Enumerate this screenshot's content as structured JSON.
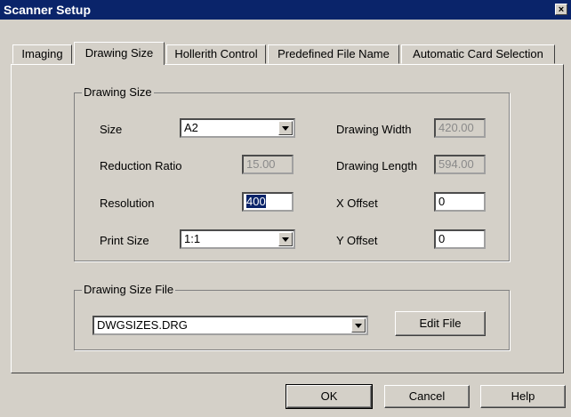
{
  "window": {
    "title": "Scanner Setup",
    "close_glyph": "×"
  },
  "tabs": [
    {
      "label": "Imaging"
    },
    {
      "label": "Drawing Size"
    },
    {
      "label": "Hollerith Control"
    },
    {
      "label": "Predefined File Name"
    },
    {
      "label": "Automatic Card Selection"
    }
  ],
  "drawing_size": {
    "group_label": "Drawing Size",
    "size_label": "Size",
    "size_value": "A2",
    "reduction_label": "Reduction Ratio",
    "reduction_value": "15.00",
    "resolution_label": "Resolution",
    "resolution_value": "400",
    "print_size_label": "Print Size",
    "print_size_value": "1:1",
    "width_label": "Drawing Width",
    "width_value": "420.00",
    "length_label": "Drawing Length",
    "length_value": "594.00",
    "x_offset_label": "X Offset",
    "x_offset_value": "0",
    "y_offset_label": "Y Offset",
    "y_offset_value": "0"
  },
  "drawing_size_file": {
    "group_label": "Drawing Size File",
    "file_value": "DWGSIZES.DRG",
    "edit_button": "Edit File"
  },
  "buttons": {
    "ok": "OK",
    "cancel": "Cancel",
    "help": "Help"
  }
}
